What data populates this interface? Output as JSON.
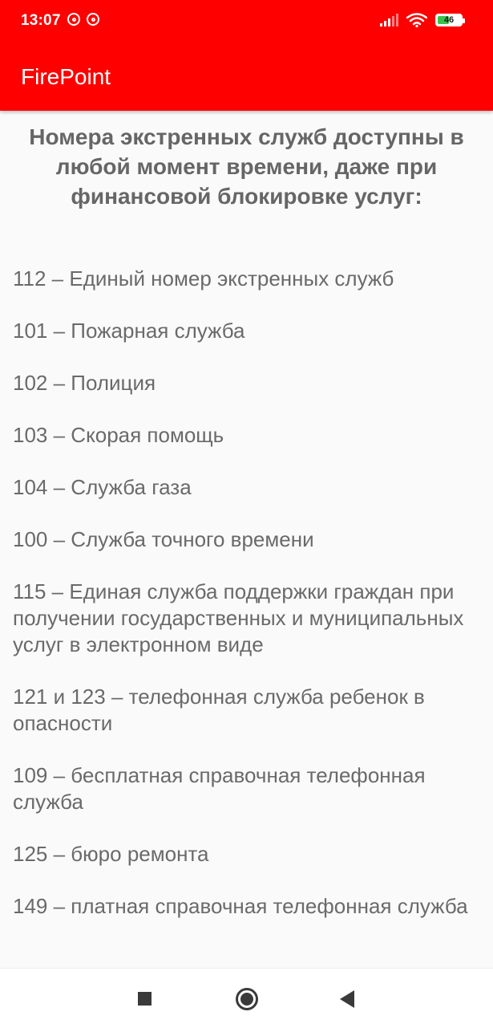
{
  "status_bar": {
    "time": "13:07",
    "battery": "46",
    "icons": [
      "notification-ring-icon",
      "notification-ring-icon",
      "signal-icon",
      "wifi-icon",
      "battery-icon"
    ]
  },
  "app_bar": {
    "title": "FirePoint",
    "color": "#ff0000"
  },
  "main": {
    "heading": "Номера экстренных служб доступны в любой момент времени, даже при финансовой блокировке услуг:",
    "items": [
      "112 – Единый номер экстренных служб",
      "101 – Пожарная служба",
      "102 – Полиция",
      "103 – Скорая помощь",
      "104 – Служба газа",
      "100 – Служба точного времени",
      "115 – Единая служба поддержки граждан при получении государственных и муниципальных услуг в электронном виде",
      "121 и 123 – телефонная служба ребенок в опасности",
      "109 – бесплатная справочная телефонная служба",
      "125 – бюро ремонта",
      "149 – платная справочная телефонная служба"
    ]
  },
  "nav_bar": {
    "icons": [
      "recent-apps-icon",
      "home-icon",
      "back-icon"
    ]
  }
}
